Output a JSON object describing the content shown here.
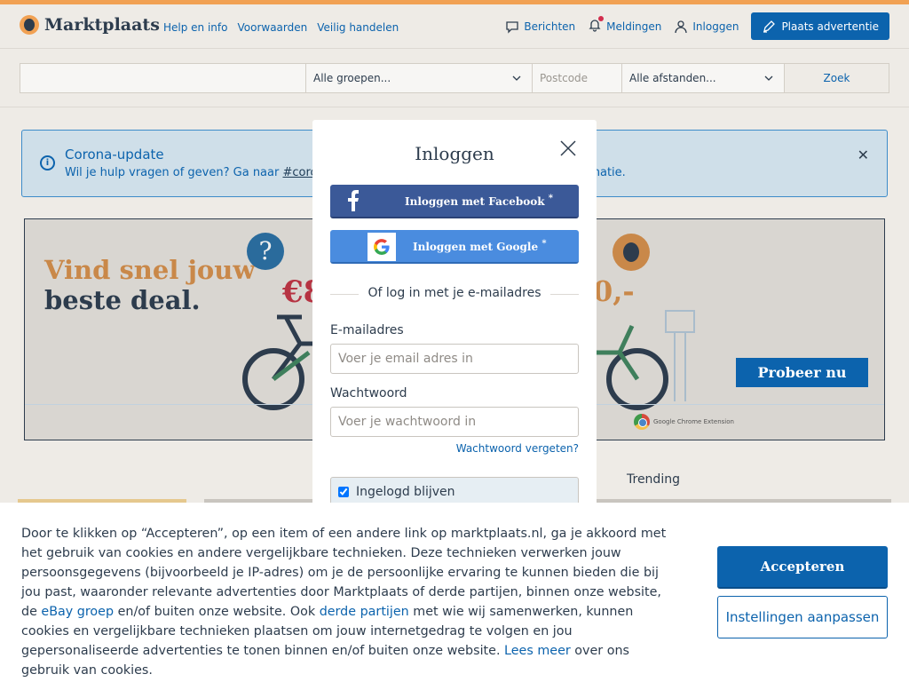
{
  "header": {
    "logo_text": "Marktplaats",
    "links": [
      "Help en info",
      "Voorwaarden",
      "Veilig handelen"
    ],
    "messages_label": "Berichten",
    "notifications_label": "Meldingen",
    "login_label": "Inloggen",
    "post_ad_label": "Plaats advertentie"
  },
  "search": {
    "query_value": "",
    "group_selected": "Alle groepen...",
    "postcode_placeholder": "Postcode",
    "distance_selected": "Alle afstanden...",
    "search_button": "Zoek"
  },
  "corona": {
    "title": "Corona-update",
    "text_before": "Wil je hulp vragen of geven? Ga naar ",
    "link": "#corona",
    "text_after": "formatie."
  },
  "ad": {
    "headline_1": "Vind snel jouw",
    "headline_2": "beste deal.",
    "question_mark": "?",
    "price_partial_1": "€8",
    "price_partial_2": "0,-",
    "cta": "Probeer nu",
    "chrome_label": "Google Chrome Extension"
  },
  "trending_label": "Trending",
  "login_modal": {
    "title": "Inloggen",
    "facebook_label": "Inloggen met Facebook",
    "google_label": "Inloggen met Google",
    "asterisk": "*",
    "divider_text": "Of log in met je e-mailadres",
    "email_label": "E-mailadres",
    "email_placeholder": "Voer je email adres in",
    "password_label": "Wachtwoord",
    "password_placeholder": "Voer je wachtwoord in",
    "forgot_password": "Wachtwoord vergeten?",
    "remember_label": "Ingelogd blijven"
  },
  "cookie": {
    "part1": "Door te klikken op “Accepteren”, op een item of een andere link op marktplaats.nl, ga je akkoord met het gebruik van cookies en andere vergelijkbare technieken. Deze technieken verwerken jouw persoonsgegevens (bijvoorbeeld je IP-adres) om je de persoonlijke ervaring te kunnen bieden die bij jou past, waaronder relevante advertenties door Marktplaats of derde partijen, binnen onze website, de ",
    "link1": "eBay groep",
    "part2": " en/of buiten onze website. Ook ",
    "link2": "derde partijen",
    "part3": " met wie wij samenwerken, kunnen cookies en vergelijkbare technieken plaatsen om jouw internetgedrag te volgen en jou gepersonaliseerde advertenties te tonen binnen en/of buiten onze website. ",
    "link3": "Lees meer",
    "part4": " over ons gebruik van cookies.",
    "accept_label": "Accepteren",
    "settings_label": "Instellingen aanpassen"
  },
  "colors": {
    "brand_blue": "#0c63ad",
    "brand_orange": "#f1a153",
    "facebook_blue": "#3b5998",
    "google_blue": "#4a8cdf"
  }
}
